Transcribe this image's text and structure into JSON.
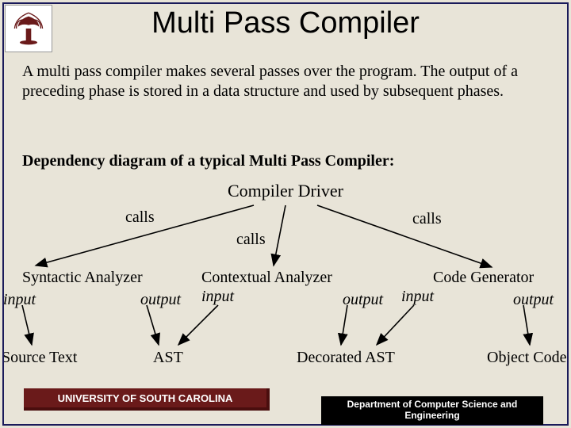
{
  "title": "Multi Pass Compiler",
  "body": "A multi pass compiler makes several passes over the program. The output of a preceding phase is stored in a data structure and used by subsequent phases.",
  "subhead": "Dependency diagram of a typical Multi Pass Compiler:",
  "driver": "Compiler Driver",
  "labels": {
    "calls_left": "calls",
    "calls_mid": "calls",
    "calls_right": "calls",
    "syntactic": "Syntactic Analyzer",
    "contextual": "Contextual Analyzer",
    "codegen": "Code Generator",
    "input1": "input",
    "output1": "output",
    "input2": "input",
    "output2": "output",
    "input3": "input",
    "output3": "output",
    "source": "Source Text",
    "ast": "AST",
    "dast": "Decorated AST",
    "obj": "Object Code"
  },
  "footer": {
    "left": "UNIVERSITY OF SOUTH CAROLINA",
    "right": "Department of Computer Science and Engineering"
  }
}
